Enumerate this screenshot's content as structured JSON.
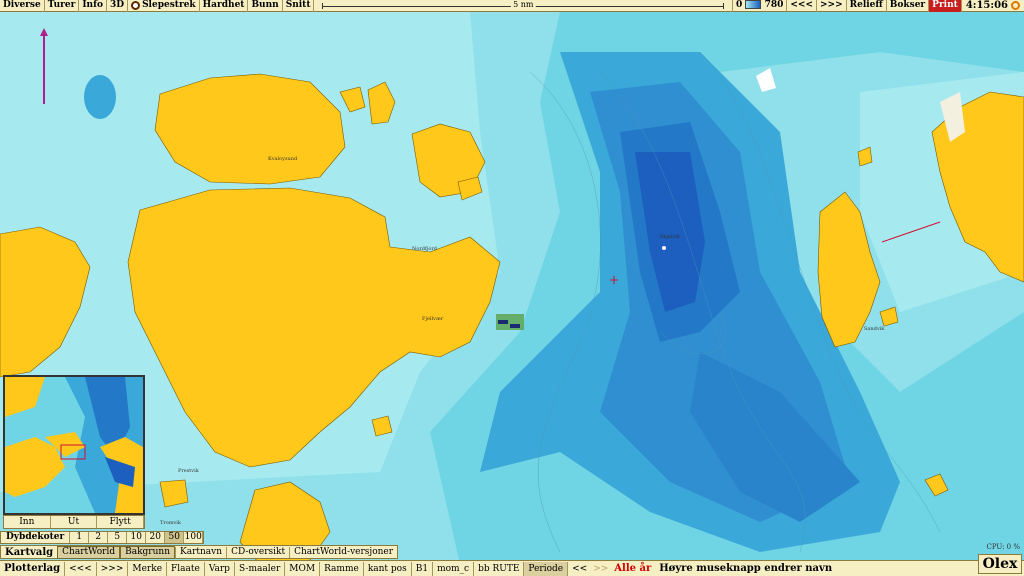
{
  "topbar": {
    "menu": [
      "Diverse",
      "Turer",
      "Info",
      "3D"
    ],
    "slepestrek": "Slepestrek",
    "menu2": [
      "Hardhet",
      "Bunn",
      "Snitt"
    ],
    "scale_label": "5 nm",
    "depth_min": "0",
    "depth_max": "780",
    "nav_prev": "<<<",
    "nav_next": ">>>",
    "relieff": "Relieff",
    "bokser": "Bokser",
    "print": "Print",
    "clock": "4:15:06"
  },
  "map": {
    "labels": [
      "Kvaloysund",
      "Nordfjord",
      "Fjellvær",
      "Prestvik",
      "Sandvik",
      "Tromvik",
      "Skjelvik"
    ],
    "colors": {
      "land": "#ffc81a",
      "shallow": "#9ee8ef",
      "mid": "#6fd4e4",
      "deep": "#3aa8d8",
      "deeper": "#2378c8",
      "deepest": "#1c5fbf"
    }
  },
  "minimap": {
    "buttons": [
      "Inn",
      "Ut",
      "Flytt"
    ]
  },
  "dybdekoter": {
    "label": "Dybdekoter",
    "values": [
      "1",
      "2",
      "5",
      "10",
      "20",
      "50",
      "100"
    ],
    "selected": "50"
  },
  "kartvalg": {
    "label": "Kartvalg",
    "items": [
      "ChartWorld",
      "Bakgrunn",
      "Kartnavn",
      "CD-oversikt",
      "ChartWorld-versjoner"
    ]
  },
  "bottombar": {
    "label": "Plotterlag",
    "prev": "<<<",
    "next": ">>>",
    "items": [
      "Merke",
      "Flaate",
      "Varp",
      "S-maaler",
      "MOM",
      "Ramme",
      "kant pos",
      "B1",
      "mom_c",
      "bb RUTE"
    ],
    "periode": "Periode",
    "periode_prev": "<<",
    "alle_ar": "Alle år",
    "message": "Høyre museknapp endrer navn"
  },
  "logo": "Olex",
  "cpu": "CPU: 0 %"
}
